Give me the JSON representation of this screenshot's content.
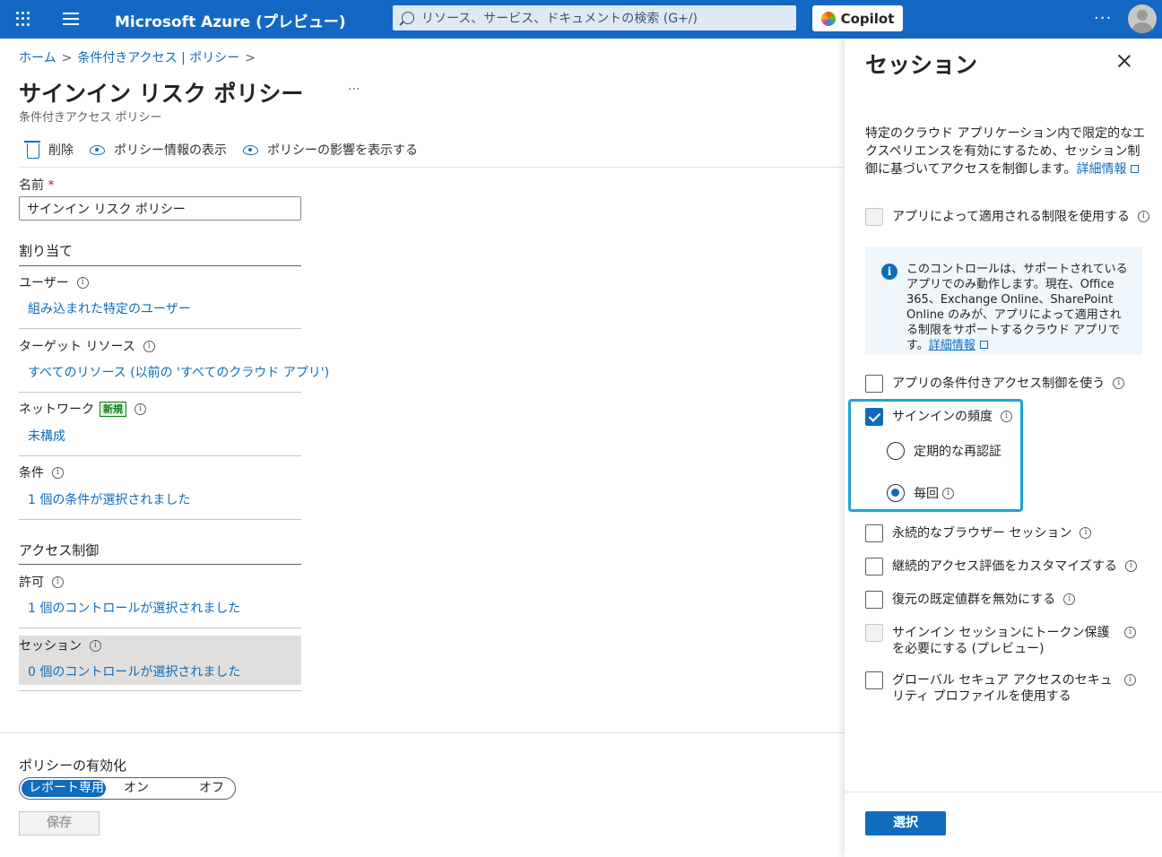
{
  "topbar": {
    "brand": "Microsoft Azure (プレビュー)",
    "search_placeholder": "リソース、サービス、ドキュメントの検索 (G+/)",
    "copilot_label": "Copilot",
    "more_label": "···"
  },
  "breadcrumb": {
    "home": "ホーム",
    "sep": ">",
    "parent": "条件付きアクセス | ポリシー"
  },
  "page": {
    "title": "サインイン リスク ポリシー",
    "more": "···",
    "subtitle": "条件付きアクセス ポリシー"
  },
  "toolbar": {
    "delete": "削除",
    "view_info": "ポリシー情報の表示",
    "view_impact": "ポリシーの影響を表示する"
  },
  "form": {
    "name_label": "名前",
    "required_mark": "*",
    "name_value": "サインイン リスク ポリシー",
    "assignments_header": "割り当て",
    "users_label": "ユーザー",
    "users_value": "組み込まれた特定のユーザー",
    "target_label": "ターゲット リソース",
    "target_value": "すべてのリソース (以前の 'すべてのクラウド アプリ')",
    "network_label": "ネットワーク",
    "network_badge": "新規",
    "network_value": "未構成",
    "conditions_label": "条件",
    "conditions_value": "1 個の条件が選択されました",
    "access_header": "アクセス制御",
    "grant_label": "許可",
    "grant_value": "1 個のコントロールが選択されました",
    "session_label": "セッション",
    "session_value": "0 個のコントロールが選択されました",
    "enable_label": "ポリシーの有効化",
    "toggle_options": [
      "レポート専用",
      "オン",
      "オフ"
    ],
    "save_label": "保存"
  },
  "panel": {
    "title": "セッション",
    "description": "特定のクラウド アプリケーション内で限定的なエクスペリエンスを有効にするため、セッション制御に基づいてアクセスを制御します。",
    "learn_more": "詳細情報",
    "app_enforced": "アプリによって適用される制限を使用する",
    "msg_text": "このコントロールは、サポートされているアプリでのみ動作します。現在、Office 365、Exchange Online、SharePoint Online のみが、アプリによって適用される制限をサポートするクラウド アプリです。",
    "msg_learn_more": "詳細情報",
    "app_ca_control": "アプリの条件付きアクセス制御を使う",
    "signin_freq": "サインインの頻度",
    "periodic_reauth": "定期的な再認証",
    "every_time": "毎回",
    "persistent_browser": "永続的なブラウザー セッション",
    "cae": "継続的アクセス評価をカスタマイズする",
    "disable_resilience": "復元の既定値群を無効にする",
    "token_protection": "サインイン セッションにトークン保護を必要にする (プレビュー)",
    "gsa_profile": "グローバル セキュア アクセスのセキュリティ プロファイルを使用する",
    "select_label": "選択"
  }
}
